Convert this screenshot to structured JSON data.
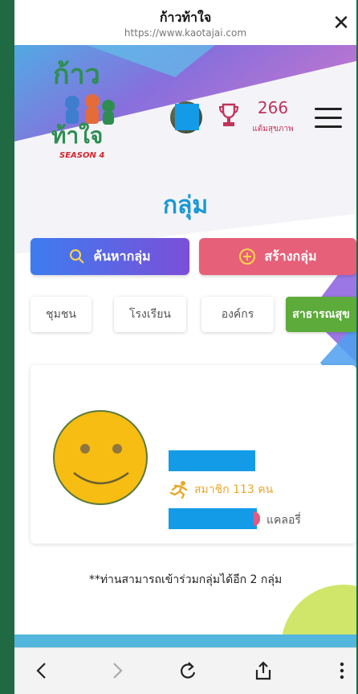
{
  "browser": {
    "title": "ก้าวท้าใจ",
    "url": "https://www.kaotajai.com"
  },
  "header": {
    "logo_text": "ก้าวท้าใจ SEASON 4",
    "points_value": "266",
    "points_label": "แต้มสุขภาพ"
  },
  "page": {
    "title": "กลุ่ม"
  },
  "actions": {
    "search_label": "ค้นหากลุ่ม",
    "create_label": "สร้างกลุ่ม"
  },
  "tabs": [
    {
      "label": "ชุมชน",
      "active": false
    },
    {
      "label": "โรงเรียน",
      "active": false
    },
    {
      "label": "องค์กร",
      "active": false
    },
    {
      "label": "สาธารณสุข",
      "active": true
    }
  ],
  "group_card": {
    "members_text": "สมาชิก 113 คน",
    "calories_label": "แคลอรี่"
  },
  "note": "**ท่านสามารถเข้าร่วมกลุ่มได้อีก 2 กลุ่ม",
  "colors": {
    "accent_blue": "#1a98d6",
    "create_pink": "#e6607a",
    "active_green": "#5dab3a",
    "points_red": "#c0335a"
  },
  "icons": {
    "close": "close-icon",
    "trophy": "trophy-icon",
    "menu": "hamburger-menu-icon",
    "search": "search-icon",
    "add": "plus-circle-icon",
    "runner": "runner-icon",
    "back": "chevron-left-icon",
    "forward": "chevron-right-icon",
    "reload": "reload-icon",
    "share": "share-icon",
    "more": "more-vertical-icon"
  }
}
